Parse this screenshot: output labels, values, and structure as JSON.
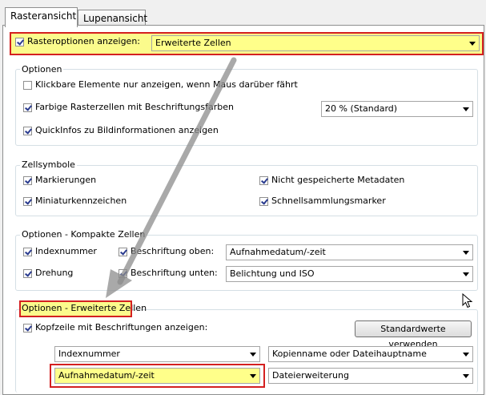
{
  "tabs": [
    {
      "label": "Rasteransicht",
      "active": true
    },
    {
      "label": "Lupenansicht",
      "active": false
    }
  ],
  "top": {
    "show_grid_label": "Rasteroptionen anzeigen:",
    "show_grid_checked": true,
    "grid_mode_value": "Erweiterte Zellen"
  },
  "options": {
    "title": "Optionen",
    "clickable_label": "Klickbare Elemente nur anzeigen, wenn Maus darüber fährt",
    "clickable_checked": false,
    "colored_cells_label": "Farbige Rasterzellen mit Beschriftungsfarben",
    "colored_cells_checked": true,
    "colored_cells_value": "20 % (Standard)",
    "quickinfo_label": "QuickInfos zu Bildinformationen anzeigen",
    "quickinfo_checked": true
  },
  "cell_symbols": {
    "title": "Zellsymbole",
    "markers_label": "Markierungen",
    "thumbnail_badges_label": "Miniaturkennzeichen",
    "unsaved_metadata_label": "Nicht gespeicherte Metadaten",
    "quick_collection_label": "Schnellsammlungsmarker"
  },
  "compact": {
    "title": "Optionen - Kompakte Zellen",
    "index_label": "Indexnummer",
    "rotation_label": "Drehung",
    "caption_top_label": "Beschriftung oben:",
    "caption_top_value": "Aufnahmedatum/-zeit",
    "caption_bottom_label": "Beschriftung unten:",
    "caption_bottom_value": "Belichtung und ISO"
  },
  "expanded": {
    "title": "Optionen - Erweiterte Zellen",
    "header_label": "Kopfzeile mit Beschriftungen anzeigen:",
    "defaults_button": "Standardwerte verwenden",
    "combo_1": "Indexnummer",
    "combo_2": "Kopienname oder Dateihauptname",
    "combo_3": "Aufnahmedatum/-zeit",
    "combo_4": "Dateierweiterung"
  },
  "colors": {
    "highlight": "#fbfb8c",
    "annotation_red": "#d42020",
    "checkmark": "#2a3b8f"
  }
}
